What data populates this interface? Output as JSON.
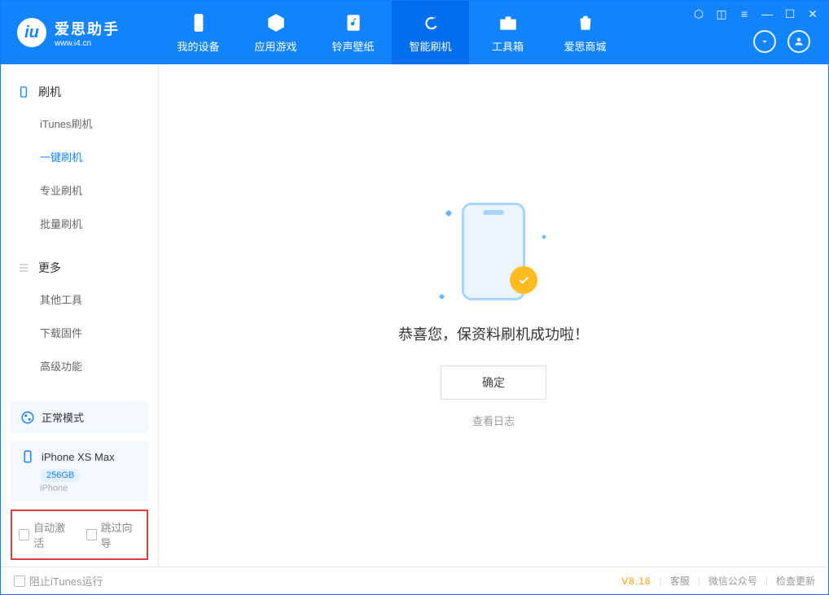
{
  "app": {
    "title": "爱思助手",
    "subtitle": "www.i4.cn"
  },
  "nav": {
    "items": [
      {
        "label": "我的设备"
      },
      {
        "label": "应用游戏"
      },
      {
        "label": "铃声壁纸"
      },
      {
        "label": "智能刷机"
      },
      {
        "label": "工具箱"
      },
      {
        "label": "爱思商城"
      }
    ]
  },
  "sidebar": {
    "section1_title": "刷机",
    "section1_items": [
      {
        "label": "iTunes刷机"
      },
      {
        "label": "一键刷机"
      },
      {
        "label": "专业刷机"
      },
      {
        "label": "批量刷机"
      }
    ],
    "section2_title": "更多",
    "section2_items": [
      {
        "label": "其他工具"
      },
      {
        "label": "下载固件"
      },
      {
        "label": "高级功能"
      }
    ],
    "mode": "正常模式",
    "device_name": "iPhone XS Max",
    "device_storage": "256GB",
    "device_type": "iPhone",
    "opt_auto_activate": "自动激活",
    "opt_skip_guide": "跳过向导"
  },
  "main": {
    "success_msg": "恭喜您，保资料刷机成功啦！",
    "ok_button": "确定",
    "view_log": "查看日志"
  },
  "footer": {
    "block_itunes": "阻止iTunes运行",
    "version": "V8.16",
    "link_service": "客服",
    "link_wechat": "微信公众号",
    "link_update": "检查更新"
  }
}
